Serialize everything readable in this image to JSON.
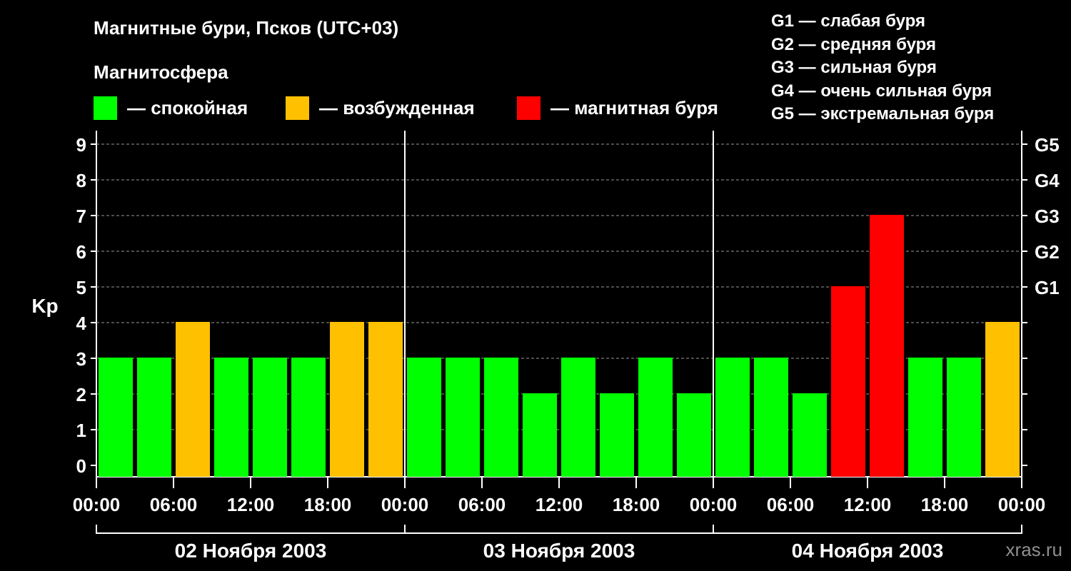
{
  "header": {
    "title": "Магнитные бури, Псков (UTC+03)",
    "subtitle": "Магнитосфера"
  },
  "legend": {
    "items": [
      {
        "label": "— спокойная",
        "color": "#00ff00"
      },
      {
        "label": "— возбужденная",
        "color": "#ffc000"
      },
      {
        "label": "— магнитная буря",
        "color": "#ff0000"
      }
    ],
    "g_scale": [
      "G1 — слабая буря",
      "G2 — средняя буря",
      "G3 — сильная буря",
      "G4 — очень сильная буря",
      "G5 — экстремальная буря"
    ]
  },
  "watermark": "xras.ru",
  "chart_data": {
    "type": "bar",
    "ylabel": "Kp",
    "ylim": [
      0,
      9
    ],
    "yticks": [
      0,
      1,
      2,
      3,
      4,
      5,
      6,
      7,
      8,
      9
    ],
    "right_axis": [
      {
        "value": 5,
        "label": "G1"
      },
      {
        "value": 6,
        "label": "G2"
      },
      {
        "value": 7,
        "label": "G3"
      },
      {
        "value": 8,
        "label": "G4"
      },
      {
        "value": 9,
        "label": "G5"
      }
    ],
    "x_tick_labels": [
      "00:00",
      "06:00",
      "12:00",
      "18:00",
      "00:00",
      "06:00",
      "12:00",
      "18:00",
      "00:00",
      "06:00",
      "12:00",
      "18:00",
      "00:00"
    ],
    "days": [
      "02 Ноября 2003",
      "03 Ноября 2003",
      "04 Ноября 2003"
    ],
    "grid": true,
    "colors": {
      "calm": "#00ff00",
      "excited": "#ffc000",
      "storm": "#ff0000"
    },
    "values": [
      3,
      3,
      4,
      3,
      3,
      3,
      4,
      4,
      3,
      3,
      3,
      2,
      3,
      2,
      3,
      2,
      3,
      3,
      2,
      5,
      7,
      3,
      3,
      4
    ]
  }
}
